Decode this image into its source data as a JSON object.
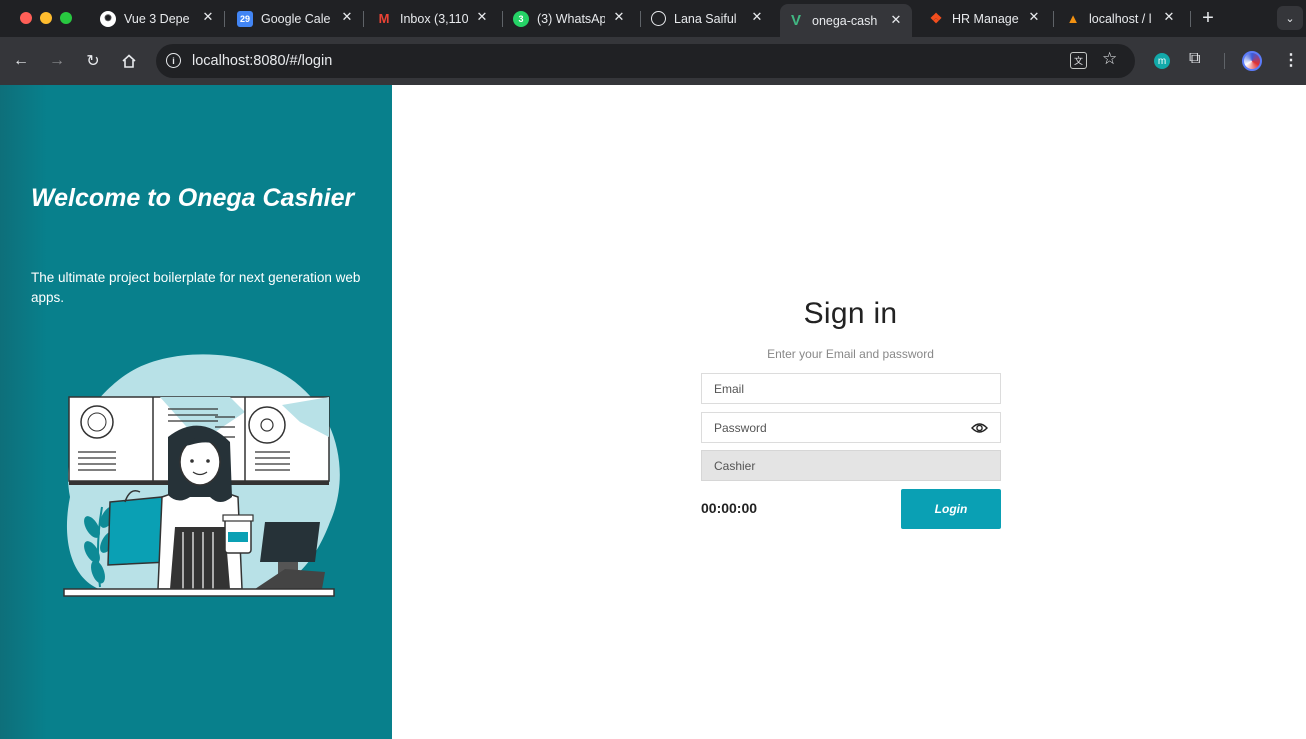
{
  "browser": {
    "tabs": [
      {
        "title": "Vue 3 Depe",
        "icon": "openai-icon"
      },
      {
        "title": "Google Cale",
        "icon": "calendar-icon",
        "badge": "29"
      },
      {
        "title": "Inbox (3,110",
        "icon": "gmail-icon"
      },
      {
        "title": "(3) WhatsAp",
        "icon": "whatsapp-icon",
        "badge": "3"
      },
      {
        "title": "Lana Saiful",
        "icon": "globe-icon"
      },
      {
        "title": "onega-cash",
        "icon": "vue-icon"
      },
      {
        "title": "HR Manage",
        "icon": "figma-icon"
      },
      {
        "title": "localhost / l",
        "icon": "phpmyadmin-icon"
      }
    ],
    "active_tab": 5,
    "url": "localhost:8080/#/login",
    "profile_initial": "m"
  },
  "left_panel": {
    "welcome": "Welcome to Onega Cashier",
    "tagline": "The ultimate project boilerplate for next generation web apps."
  },
  "signin": {
    "title": "Sign in",
    "subtitle": "Enter your Email and password",
    "email_placeholder": "Email",
    "password_placeholder": "Password",
    "role_value": "Cashier",
    "timer": "00:00:00",
    "login_label": "Login"
  },
  "colors": {
    "panel": "#08808c",
    "button": "#0aa0b4"
  }
}
